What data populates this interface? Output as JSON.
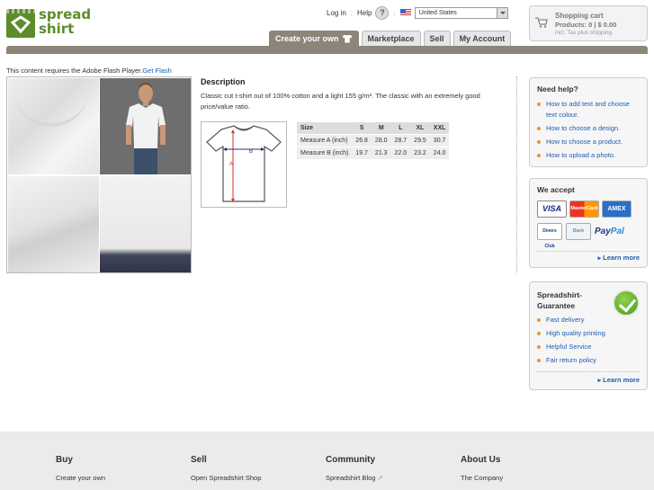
{
  "brand": {
    "line1": "spread",
    "line2": "shirt",
    "color": "#5d8c2b"
  },
  "toplinks": {
    "login": "Log in",
    "help": "Help",
    "help_icon": "?",
    "country": "United States"
  },
  "cart": {
    "title": "Shopping cart",
    "products": "Products: 0 | $ 0.00",
    "tax": "incl. Tax plus shipping"
  },
  "nav": {
    "tabs": [
      "Create your own",
      "Marketplace",
      "Sell",
      "My Account"
    ]
  },
  "flash": {
    "text": "This content requires the Adobe Flash Player.",
    "link": "Get Flash"
  },
  "description": {
    "title": "Description",
    "text": "Classic cut t-shirt out of 100% cotton and a light 155 g/m². The classic with an extremely good price/value ratio."
  },
  "diagram": {
    "label_a": "A",
    "label_b": "B"
  },
  "size_table": {
    "headers": [
      "Size",
      "S",
      "M",
      "L",
      "XL",
      "XXL"
    ],
    "rows": [
      [
        "Measure A (inch)",
        "26.8",
        "28.0",
        "28.7",
        "29.5",
        "30.7"
      ],
      [
        "Measure B (inch)",
        "19.7",
        "21.3",
        "22.0",
        "23.2",
        "24.0"
      ]
    ]
  },
  "help_box": {
    "title": "Need help?",
    "items": [
      "How to add text and choose text colour.",
      "How to choose a design.",
      "How to choose a product.",
      "How to upload a photo."
    ]
  },
  "accept_box": {
    "title": "We accept",
    "cards": [
      "VISA",
      "MasterCard",
      "AMEX",
      "Diners Club",
      "Bank"
    ],
    "paypal_a": "Pay",
    "paypal_b": "Pal",
    "more": "Learn more"
  },
  "guarantee_box": {
    "title": "Spreadshirt-Guarantee",
    "items": [
      "Fast delivery",
      "High quality printing",
      "Helpful Service",
      "Fair return policy"
    ],
    "more": "Learn more"
  },
  "footer": {
    "cols": [
      {
        "title": "Buy",
        "link": "Create your own"
      },
      {
        "title": "Sell",
        "link": "Open Spreadshirt Shop"
      },
      {
        "title": "Community",
        "link": "Spreadshirt Blog"
      },
      {
        "title": "About Us",
        "link": "The Company"
      }
    ]
  }
}
